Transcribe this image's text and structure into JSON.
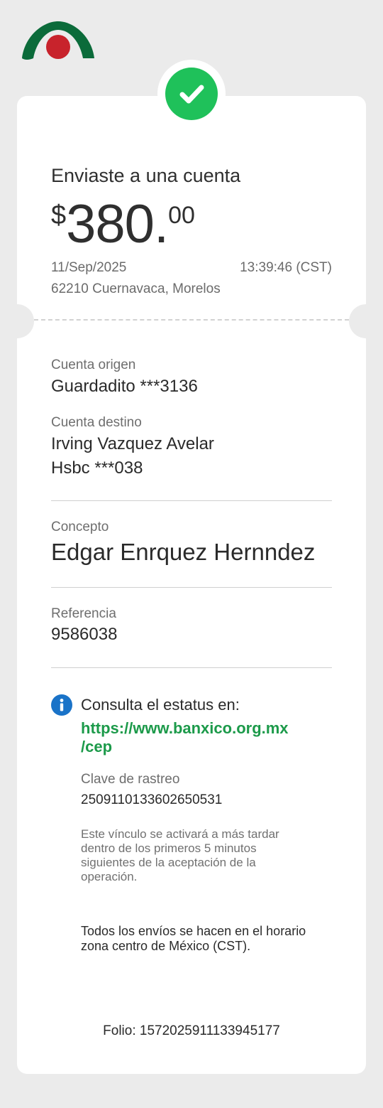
{
  "receipt": {
    "title": "Enviaste a una cuenta",
    "amount": {
      "currency_symbol": "$",
      "whole": "380.",
      "cents": "00"
    },
    "date": "11/Sep/2025",
    "time": "13:39:46 (CST)",
    "location": "62210 Cuernavaca, Morelos"
  },
  "details": {
    "origin_label": "Cuenta origen",
    "origin_value": "Guardadito ***3136",
    "dest_label": "Cuenta destino",
    "dest_name": "Irving Vazquez Avelar",
    "dest_bank": "Hsbc ***038",
    "concept_label": "Concepto",
    "concept_value": "Edgar Enrquez Hernndez",
    "reference_label": "Referencia",
    "reference_value": "9586038"
  },
  "status": {
    "consult_text": "Consulta el estatus en:",
    "link_line1": "https://www.banxico.org.mx",
    "link_line2": "/cep",
    "tracking_label": "Clave de rastreo",
    "tracking_value": "2509110133602650531",
    "activation_note_lines": [
      "Este vínculo se activará a más tardar",
      "dentro de los primeros 5 minutos",
      "siguientes de la aceptación de la",
      "operación."
    ],
    "timezone_note_lines": [
      "Todos los envíos se hacen en el horario",
      "zona centro de México (CST)."
    ]
  },
  "footer": {
    "folio": "Folio: 1572025911133945177"
  },
  "icons": {
    "logo": "bank-logo",
    "success": "check-icon",
    "info": "info-icon"
  },
  "colors": {
    "success_green": "#1fc15a",
    "link_green": "#1c9a4a",
    "info_blue": "#1a73c8",
    "logo_green": "#0b6b3a",
    "logo_red": "#c8232c"
  }
}
